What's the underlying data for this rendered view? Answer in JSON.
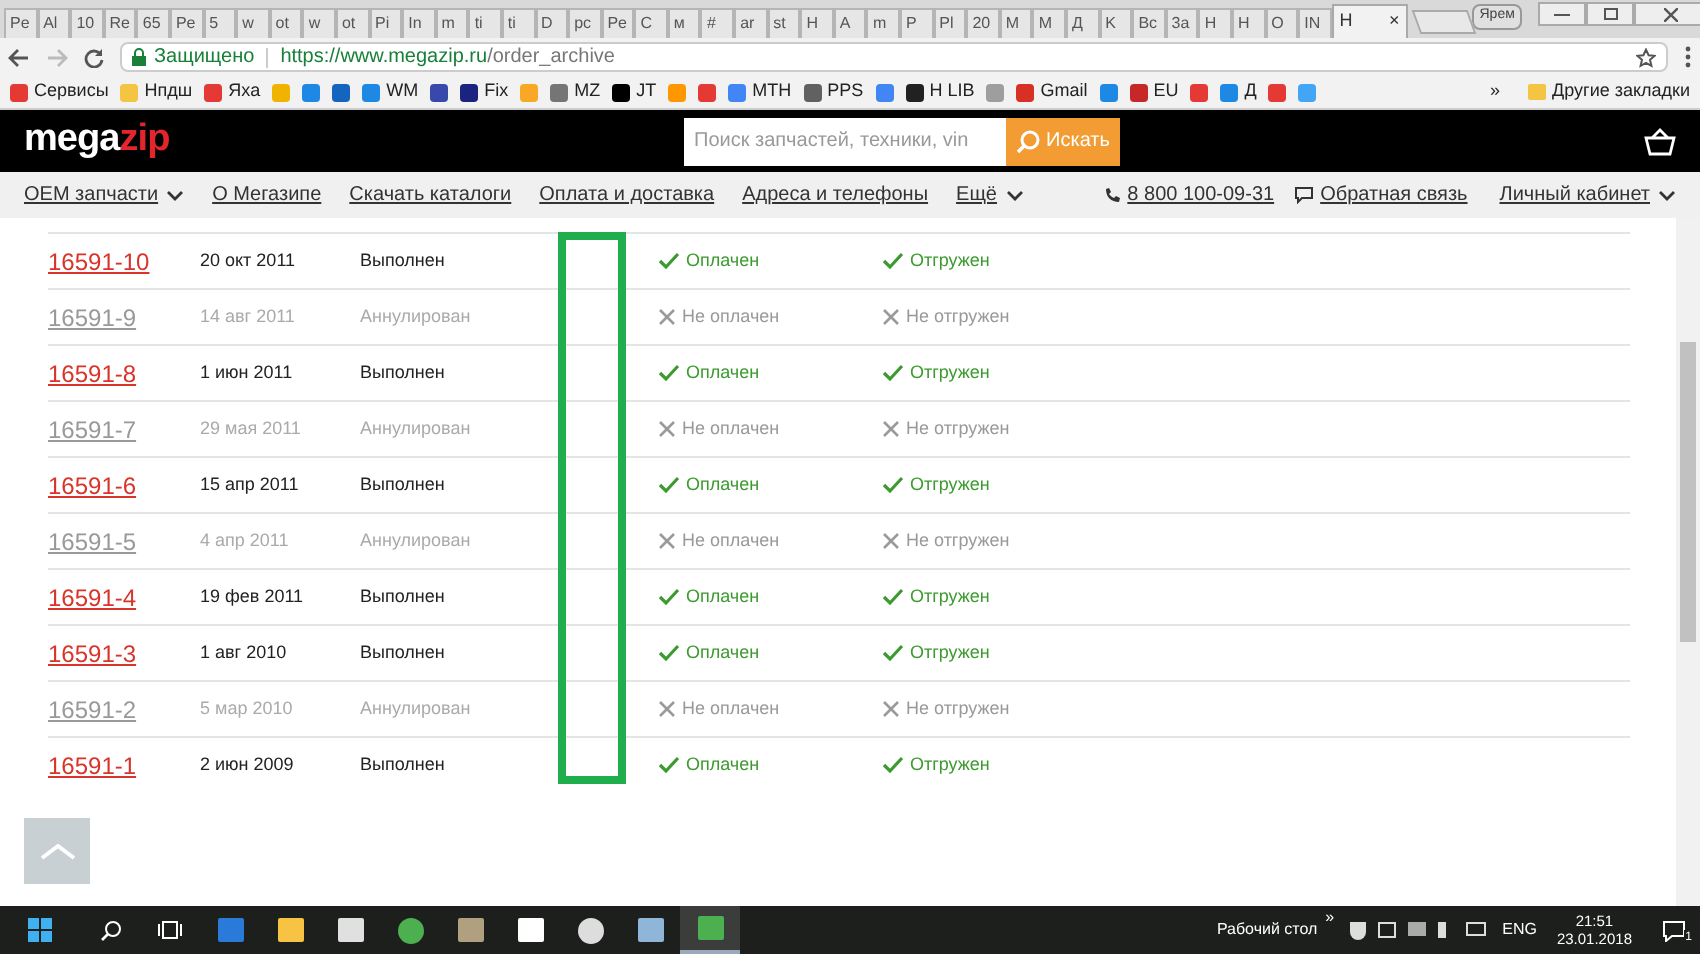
{
  "browser": {
    "tabs": [
      {
        "title": "Pe",
        "selected": false
      },
      {
        "title": "Al",
        "selected": false
      },
      {
        "title": "10",
        "selected": false
      },
      {
        "title": "Re",
        "selected": false
      },
      {
        "title": "65",
        "selected": false
      },
      {
        "title": "Pe",
        "selected": false
      },
      {
        "title": "5",
        "selected": false
      },
      {
        "title": "w",
        "selected": false
      },
      {
        "title": "ot",
        "selected": false
      },
      {
        "title": "w",
        "selected": false
      },
      {
        "title": "ot",
        "selected": false
      },
      {
        "title": "Pi",
        "selected": false
      },
      {
        "title": "In",
        "selected": false
      },
      {
        "title": "m",
        "selected": false
      },
      {
        "title": "ti",
        "selected": false
      },
      {
        "title": "ti",
        "selected": false
      },
      {
        "title": "D",
        "selected": false
      },
      {
        "title": "pc",
        "selected": false
      },
      {
        "title": "Pe",
        "selected": false
      },
      {
        "title": "C",
        "selected": false
      },
      {
        "title": "м",
        "selected": false
      },
      {
        "title": "#",
        "selected": false
      },
      {
        "title": "ar",
        "selected": false
      },
      {
        "title": "st",
        "selected": false
      },
      {
        "title": "H",
        "selected": false
      },
      {
        "title": "A",
        "selected": false
      },
      {
        "title": "m",
        "selected": false
      },
      {
        "title": "P",
        "selected": false
      },
      {
        "title": "Pl",
        "selected": false
      },
      {
        "title": "20",
        "selected": false
      },
      {
        "title": "M",
        "selected": false
      },
      {
        "title": "M",
        "selected": false
      },
      {
        "title": "Д",
        "selected": false
      },
      {
        "title": "K",
        "selected": false
      },
      {
        "title": "Bc",
        "selected": false
      },
      {
        "title": "3a",
        "selected": false
      },
      {
        "title": "H",
        "selected": false
      },
      {
        "title": "H",
        "selected": false
      },
      {
        "title": "O",
        "selected": false
      },
      {
        "title": "IN",
        "selected": false
      },
      {
        "title": "H",
        "selected": true
      }
    ],
    "close_tab": "×",
    "user_badge": "Ярем",
    "secure_label": "Защищено",
    "url_host": "https://www.megazip.ru",
    "url_path": "/order_archive",
    "bookmarks": [
      {
        "label": "Сервисы",
        "color": "#e53935"
      },
      {
        "label": "Нпдш",
        "color": "#f4c542"
      },
      {
        "label": "Яхa",
        "color": "#e53935"
      },
      {
        "color": "#f0b400"
      },
      {
        "color": "#1e88e5"
      },
      {
        "color": "#1565c0"
      },
      {
        "label": "WM",
        "color": "#1e88e5"
      },
      {
        "color": "#3949ab"
      },
      {
        "label": "Fix",
        "color": "#1a237e"
      },
      {
        "color": "#f9a825"
      },
      {
        "label": "MZ",
        "color": "#757575"
      },
      {
        "label": "JT",
        "color": "#000000"
      },
      {
        "color": "#ff9800"
      },
      {
        "color": "#e53935"
      },
      {
        "label": "MTH",
        "color": "#4285f4"
      },
      {
        "label": "PPS",
        "color": "#616161"
      },
      {
        "color": "#4285f4"
      },
      {
        "label": "H LIB",
        "color": "#212121"
      },
      {
        "color": "#9e9e9e"
      },
      {
        "label": "Gmail",
        "color": "#d93025"
      },
      {
        "color": "#1e88e5"
      },
      {
        "label": "EU",
        "color": "#c62828"
      },
      {
        "color": "#e53935"
      },
      {
        "label": "Д",
        "color": "#1e88e5"
      },
      {
        "color": "#e53935"
      },
      {
        "color": "#42a5f5"
      }
    ],
    "more_bookmarks": "»",
    "other_bookmarks": "Другие закладки"
  },
  "site": {
    "logo_left": "mega",
    "logo_right": "zip",
    "search": {
      "placeholder": "Поиск запчастей, техники, vin"
    },
    "search_button": "Искать",
    "nav": [
      {
        "label": "OEM запчасти",
        "dropdown": true
      },
      {
        "label": "О Мегазипе",
        "dropdown": false
      },
      {
        "label": "Скачать каталоги",
        "dropdown": false
      },
      {
        "label": "Оплата и доставка",
        "dropdown": false
      },
      {
        "label": "Адреса и телефоны",
        "dropdown": false
      },
      {
        "label": "Ещё",
        "dropdown": true
      }
    ],
    "phone": "8 800 100-09-31",
    "feedback": "Обратная связь",
    "account": "Личный кабинет"
  },
  "orders": [
    {
      "number": "16591-10",
      "date": "20 окт 2011",
      "status": "Выполнен",
      "payment": "Оплачен",
      "shipping": "Отгружен",
      "kind": "done"
    },
    {
      "number": "16591-9",
      "date": "14 авг 2011",
      "status": "Аннулирован",
      "payment": "Не оплачен",
      "shipping": "Не отгружен",
      "kind": "cancelled"
    },
    {
      "number": "16591-8",
      "date": "1 июн 2011",
      "status": "Выполнен",
      "payment": "Оплачен",
      "shipping": "Отгружен",
      "kind": "done"
    },
    {
      "number": "16591-7",
      "date": "29 мая 2011",
      "status": "Аннулирован",
      "payment": "Не оплачен",
      "shipping": "Не отгружен",
      "kind": "cancelled"
    },
    {
      "number": "16591-6",
      "date": "15 апр 2011",
      "status": "Выполнен",
      "payment": "Оплачен",
      "shipping": "Отгружен",
      "kind": "done"
    },
    {
      "number": "16591-5",
      "date": "4 апр 2011",
      "status": "Аннулирован",
      "payment": "Не оплачен",
      "shipping": "Не отгружен",
      "kind": "cancelled"
    },
    {
      "number": "16591-4",
      "date": "19 фев 2011",
      "status": "Выполнен",
      "payment": "Оплачен",
      "shipping": "Отгружен",
      "kind": "done"
    },
    {
      "number": "16591-3",
      "date": "1 авг 2010",
      "status": "Выполнен",
      "payment": "Оплачен",
      "shipping": "Отгружен",
      "kind": "done"
    },
    {
      "number": "16591-2",
      "date": "5 мар 2010",
      "status": "Аннулирован",
      "payment": "Не оплачен",
      "shipping": "Не отгружен",
      "kind": "cancelled"
    },
    {
      "number": "16591-1",
      "date": "2 июн 2009",
      "status": "Выполнен",
      "payment": "Оплачен",
      "shipping": "Отгружен",
      "kind": "done"
    }
  ],
  "taskbar": {
    "desktop_label": "Рабочий стол",
    "chevron": "»",
    "language": "ENG",
    "time": "21:51",
    "date": "23.01.2018",
    "notifications": "1"
  }
}
